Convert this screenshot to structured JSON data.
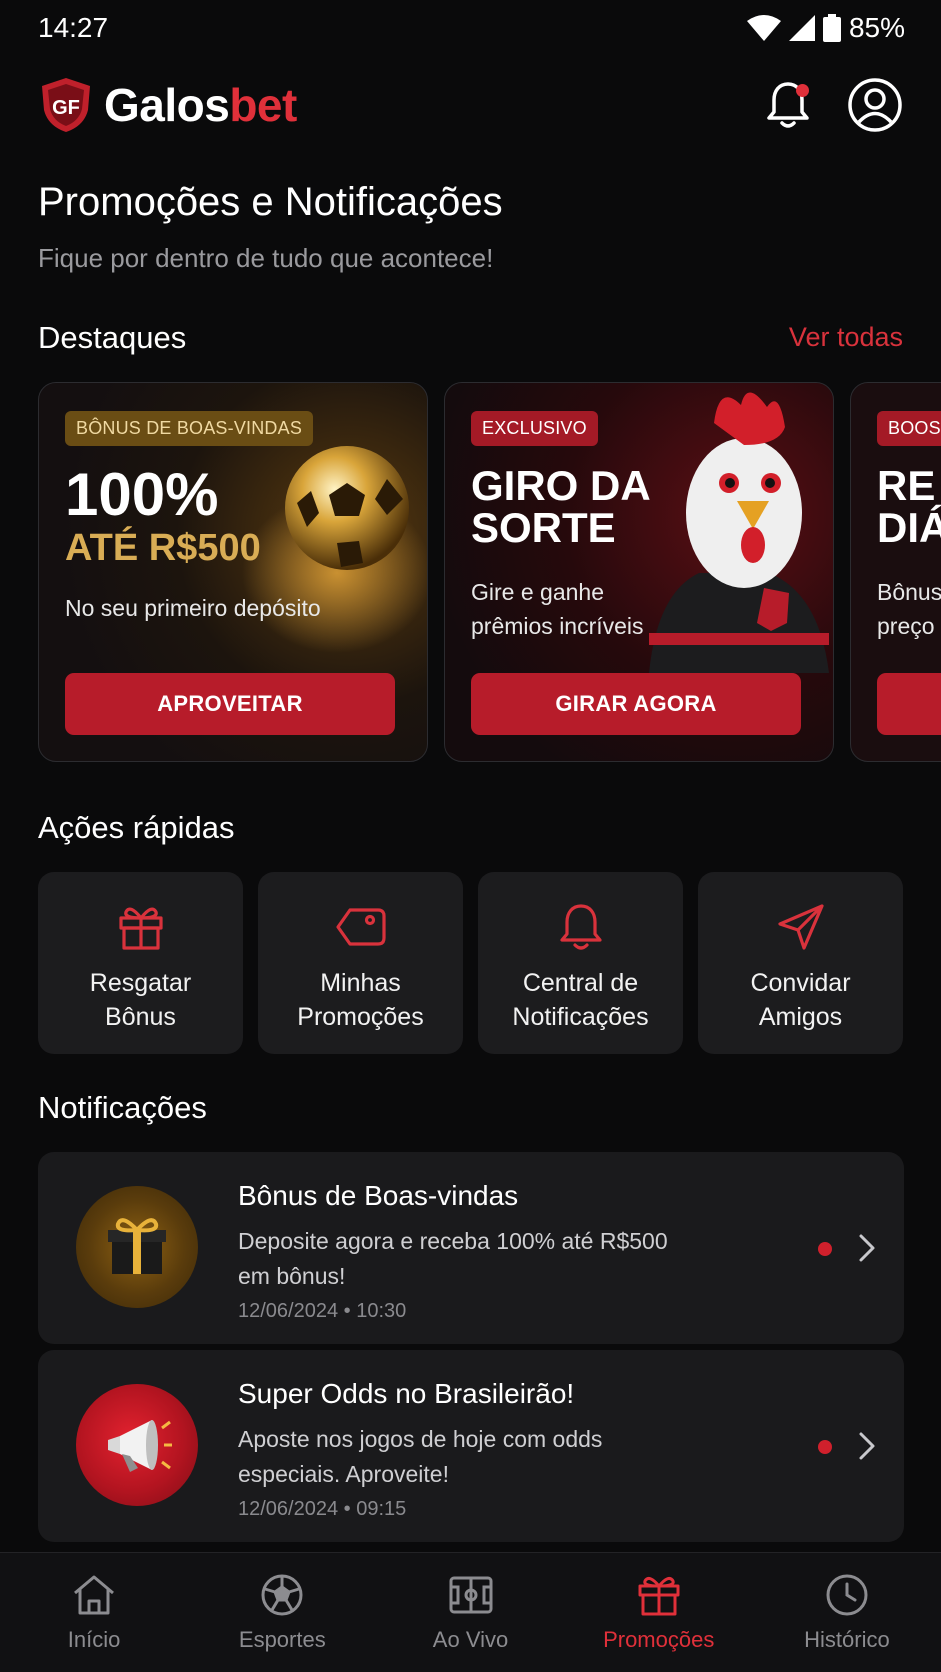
{
  "status_bar": {
    "time": "14:27",
    "battery": "85%"
  },
  "header": {
    "logo_main": "Galos",
    "logo_accent": "bet"
  },
  "page": {
    "title": "Promoções e Notificações",
    "subtitle": "Fique por dentro de tudo que acontece!"
  },
  "highlights": {
    "title": "Destaques",
    "see_all": "Ver todas",
    "cards": [
      {
        "badge": "BÔNUS DE BOAS-VINDAS",
        "heading1": "100%",
        "heading2": "ATÉ R$500",
        "text": "No seu primeiro depósito",
        "button": "APROVEITAR"
      },
      {
        "badge": "EXCLUSIVO",
        "heading1": "GIRO DA",
        "heading2": "SORTE",
        "text1": "Gire e ganhe",
        "text2": "prêmios incríveis",
        "button": "GIRAR AGORA"
      },
      {
        "badge": "BOOST",
        "heading1": "RE",
        "heading2": "DIÁ",
        "text1": "Bônus",
        "text2": "preço"
      }
    ]
  },
  "quick_actions": {
    "title": "Ações rápidas",
    "items": [
      {
        "label": "Resgatar\nBônus",
        "icon": "gift-icon"
      },
      {
        "label": "Minhas\nPromoções",
        "icon": "tag-icon"
      },
      {
        "label": "Central de\nNotificações",
        "icon": "bell-icon"
      },
      {
        "label": "Convidar\nAmigos",
        "icon": "send-icon"
      }
    ]
  },
  "notifications": {
    "title": "Notificações",
    "items": [
      {
        "title": "Bônus de Boas-vindas",
        "desc": "Deposite agora e receba 100% até R$500 em bônus!",
        "time": "12/06/2024 • 10:30"
      },
      {
        "title": "Super Odds no Brasileirão!",
        "desc": "Aposte nos jogos de hoje com odds especiais. Aproveite!",
        "time": "12/06/2024 • 09:15"
      }
    ]
  },
  "bottom_nav": {
    "items": [
      {
        "label": "Início",
        "icon": "home-icon"
      },
      {
        "label": "Esportes",
        "icon": "soccer-ball-icon"
      },
      {
        "label": "Ao Vivo",
        "icon": "field-icon"
      },
      {
        "label": "Promoções",
        "icon": "gift-icon"
      },
      {
        "label": "Histórico",
        "icon": "clock-icon"
      }
    ],
    "active": "Promoções"
  },
  "colors": {
    "accent": "#e0303a",
    "button": "#b71c2a",
    "background": "#0a0a0b",
    "card": "#1c1c1e",
    "gold": "#d9ad55"
  }
}
